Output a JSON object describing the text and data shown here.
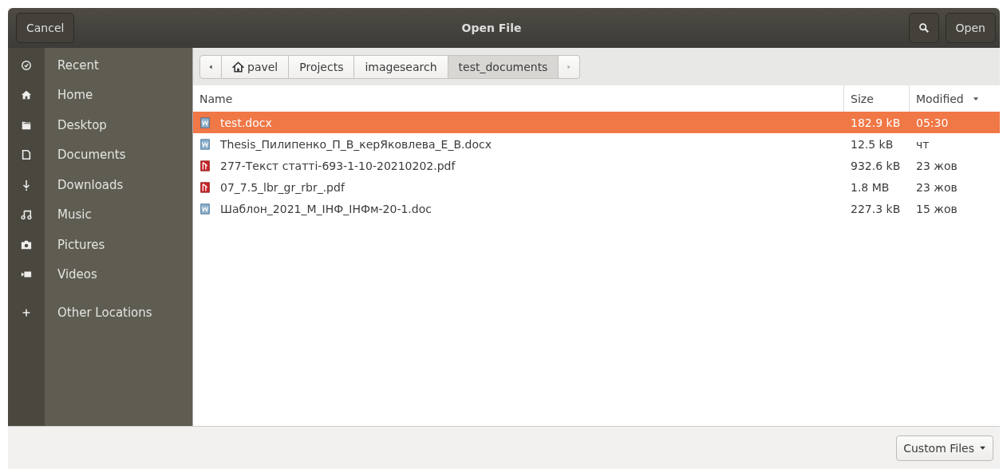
{
  "window": {
    "title": "Open File"
  },
  "header": {
    "cancel": "Cancel",
    "open": "Open"
  },
  "sidebar": {
    "items": [
      {
        "label": "Recent",
        "kind": "recent",
        "selected": false
      },
      {
        "label": "Home",
        "kind": "home",
        "selected": false
      },
      {
        "label": "Desktop",
        "kind": "folder",
        "selected": false
      },
      {
        "label": "Documents",
        "kind": "document",
        "selected": false
      },
      {
        "label": "Downloads",
        "kind": "download",
        "selected": false
      },
      {
        "label": "Music",
        "kind": "music",
        "selected": false
      },
      {
        "label": "Pictures",
        "kind": "camera",
        "selected": false
      },
      {
        "label": "Videos",
        "kind": "video",
        "selected": false
      },
      {
        "label": "Other Locations",
        "kind": "add",
        "selected": false
      }
    ]
  },
  "path_bar": {
    "crumbs": [
      {
        "label": "pavel",
        "home": true,
        "selected": false
      },
      {
        "label": "Projects",
        "home": false,
        "selected": false
      },
      {
        "label": "imagesearch",
        "home": false,
        "selected": false
      },
      {
        "label": "test_documents",
        "home": false,
        "selected": true
      }
    ]
  },
  "table": {
    "columns": [
      "Name",
      "Size",
      "Modified"
    ],
    "rows": [
      {
        "name": "test.docx",
        "kind": "word",
        "size": "182.9 kB",
        "modified": "05:30",
        "selected": true
      },
      {
        "name": "Thesis_Пилипенко_П_В_керЯковлева_Е_В.docx",
        "kind": "word",
        "size": "12.5 kB",
        "modified": "чт",
        "selected": false
      },
      {
        "name": "277-Текст статті-693-1-10-20210202.pdf",
        "kind": "pdf",
        "size": "932.6 kB",
        "modified": "23 жов",
        "selected": false
      },
      {
        "name": "07_7.5_lbr_gr_rbr_.pdf",
        "kind": "pdf",
        "size": "1.8 MB",
        "modified": "23 жов",
        "selected": false
      },
      {
        "name": "Шаблон_2021_М_ІНФ_ІНФм-20-1.doc",
        "kind": "word",
        "size": "227.3 kB",
        "modified": "15 жов",
        "selected": false
      }
    ]
  },
  "filter": {
    "label": "Custom Files"
  }
}
